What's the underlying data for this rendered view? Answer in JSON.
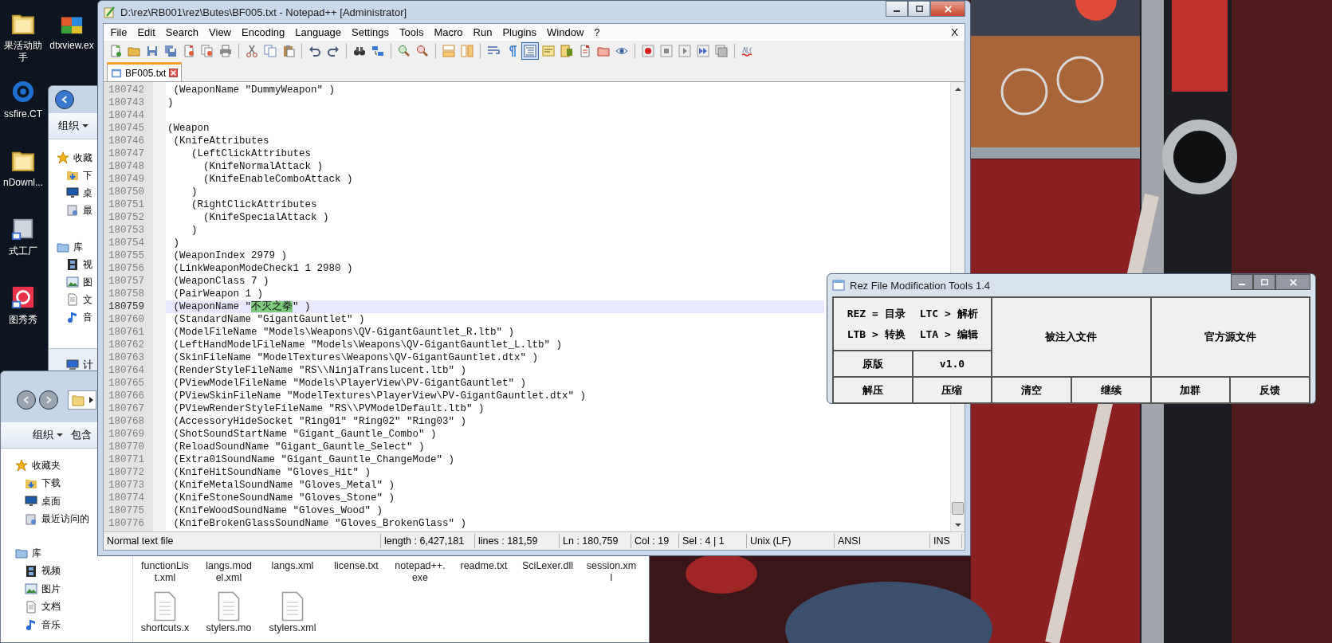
{
  "desktop": {
    "icons": [
      {
        "label": "果活动助手",
        "kind": "folder"
      },
      {
        "label": "ssfire.CT",
        "kind": "gear"
      },
      {
        "label": "nDownl...",
        "kind": "folder"
      },
      {
        "label": "式工厂",
        "kind": "converter"
      },
      {
        "label": "图秀秀",
        "kind": "red-app"
      }
    ],
    "second_column": [
      {
        "label": "dtxview.ex",
        "kind": "mfc"
      }
    ]
  },
  "explorer_back": {
    "organize": "组织",
    "nav": [
      {
        "label": "收藏",
        "kind": "star"
      },
      {
        "label": "下",
        "kind": "download"
      },
      {
        "label": "桌",
        "kind": "desktop"
      },
      {
        "label": "最",
        "kind": "recent"
      },
      {
        "label": "库",
        "kind": "library"
      },
      {
        "label": "视",
        "kind": "video"
      },
      {
        "label": "图",
        "kind": "picture"
      },
      {
        "label": "文",
        "kind": "document"
      },
      {
        "label": "音",
        "kind": "music"
      }
    ],
    "details": {
      "label": "计",
      "kind": "computer"
    }
  },
  "explorer_front": {
    "organize": "组织",
    "include": "包含",
    "nav": [
      {
        "label": "收藏夹",
        "kind": "star"
      },
      {
        "label": "下载",
        "kind": "download"
      },
      {
        "label": "桌面",
        "kind": "desktop"
      },
      {
        "label": "最近访问的",
        "kind": "recent"
      },
      {
        "label": "库",
        "kind": "library"
      },
      {
        "label": "视频",
        "kind": "video"
      },
      {
        "label": "图片",
        "kind": "picture"
      },
      {
        "label": "文档",
        "kind": "document"
      },
      {
        "label": "音乐",
        "kind": "music"
      }
    ],
    "files": [
      {
        "label": "functionList.xml"
      },
      {
        "label": "langs.model.xml"
      },
      {
        "label": "langs.xml"
      },
      {
        "label": "license.txt"
      },
      {
        "label": "notepad++.exe"
      },
      {
        "label": "readme.txt"
      },
      {
        "label": "SciLexer.dll"
      },
      {
        "label": "session.xml"
      }
    ],
    "files_row2": [
      {
        "label": "shortcuts.x"
      },
      {
        "label": "stylers.mo"
      },
      {
        "label": "stylers.xml"
      }
    ]
  },
  "notepad": {
    "title": "D:\\rez\\RB001\\rez\\Butes\\BF005.txt - Notepad++ [Administrator]",
    "menu": [
      "File",
      "Edit",
      "Search",
      "View",
      "Encoding",
      "Language",
      "Settings",
      "Tools",
      "Macro",
      "Run",
      "Plugins",
      "Window",
      "?"
    ],
    "doc_close": "X",
    "toolbar": [
      [
        {
          "kind": "new",
          "pressed": false
        },
        {
          "kind": "open",
          "pressed": false
        },
        {
          "kind": "save",
          "pressed": false
        },
        {
          "kind": "saveall",
          "pressed": false
        },
        {
          "kind": "close",
          "pressed": false
        },
        {
          "kind": "closeall",
          "pressed": false
        },
        {
          "kind": "print",
          "pressed": false
        }
      ],
      [
        {
          "kind": "cut",
          "pressed": false
        },
        {
          "kind": "copy",
          "pressed": false
        },
        {
          "kind": "paste",
          "pressed": false
        }
      ],
      [
        {
          "kind": "undo",
          "pressed": false
        },
        {
          "kind": "redo",
          "pressed": false
        }
      ],
      [
        {
          "kind": "find",
          "pressed": false
        },
        {
          "kind": "replace",
          "pressed": false
        }
      ],
      [
        {
          "kind": "zoomin",
          "pressed": false
        },
        {
          "kind": "zoomout",
          "pressed": false
        }
      ],
      [
        {
          "kind": "syncv",
          "pressed": false
        },
        {
          "kind": "synch",
          "pressed": false
        }
      ],
      [
        {
          "kind": "wrap",
          "pressed": false
        },
        {
          "kind": "allchars",
          "pressed": false
        },
        {
          "kind": "indent",
          "pressed": true
        },
        {
          "kind": "udl",
          "pressed": false
        },
        {
          "kind": "docmap",
          "pressed": false
        },
        {
          "kind": "funclist",
          "pressed": false
        },
        {
          "kind": "folderws",
          "pressed": false
        },
        {
          "kind": "monitor",
          "pressed": false
        }
      ],
      [
        {
          "kind": "record",
          "pressed": false
        },
        {
          "kind": "stop",
          "pressed": false
        },
        {
          "kind": "play",
          "pressed": false
        },
        {
          "kind": "playmulti",
          "pressed": false
        },
        {
          "kind": "savemacro",
          "pressed": false
        }
      ],
      [
        {
          "kind": "spell",
          "pressed": false
        }
      ]
    ],
    "tabs": [
      {
        "label": "BF005.txt",
        "selected": true
      }
    ],
    "lines": [
      {
        "no": "180742",
        "text": " (WeaponName \"DummyWeapon\" )",
        "current": false
      },
      {
        "no": "180743",
        "text": ")",
        "current": false
      },
      {
        "no": "180744",
        "current": false
      },
      {
        "no": "180745",
        "text": "(Weapon",
        "current": false
      },
      {
        "no": "180746",
        "text": " (KnifeAttributes",
        "current": false
      },
      {
        "no": "180747",
        "text": "    (LeftClickAttributes",
        "current": false
      },
      {
        "no": "180748",
        "text": "      (KnifeNormalAttack )",
        "current": false
      },
      {
        "no": "180749",
        "text": "      (KnifeEnableComboAttack )",
        "current": false
      },
      {
        "no": "180750",
        "text": "    )",
        "current": false
      },
      {
        "no": "180751",
        "text": "    (RightClickAttributes",
        "current": false
      },
      {
        "no": "180752",
        "text": "      (KnifeSpecialAttack )",
        "current": false
      },
      {
        "no": "180753",
        "text": "    )",
        "current": false
      },
      {
        "no": "180754",
        "text": " )",
        "current": false
      },
      {
        "no": "180755",
        "text": " (WeaponIndex 2979 )",
        "current": false
      },
      {
        "no": "180756",
        "text": " (LinkWeaponModeCheck1 1 2980 )",
        "current": false
      },
      {
        "no": "180757",
        "text": " (WeaponClass 7 )",
        "current": false
      },
      {
        "no": "180758",
        "text": " (PairWeapon 1 )",
        "current": false
      },
      {
        "no": "180759",
        "text": " (WeaponName \"",
        "selection": "不灭之拳",
        "after": "\" )",
        "current": true
      },
      {
        "no": "180760",
        "text": " (StandardName \"GigantGauntlet\" )",
        "current": false
      },
      {
        "no": "180761",
        "text": " (ModelFileName \"Models\\Weapons\\QV-GigantGauntlet_R.ltb\" )",
        "current": false
      },
      {
        "no": "180762",
        "text": " (LeftHandModelFileName \"Models\\Weapons\\QV-GigantGauntlet_L.ltb\" )",
        "current": false
      },
      {
        "no": "180763",
        "text": " (SkinFileName \"ModelTextures\\Weapons\\QV-GigantGauntlet.dtx\" )",
        "current": false
      },
      {
        "no": "180764",
        "text": " (RenderStyleFileName \"RS\\\\NinjaTranslucent.ltb\" )",
        "current": false
      },
      {
        "no": "180765",
        "text": " (PViewModelFileName \"Models\\PlayerView\\PV-GigantGauntlet\" )",
        "current": false
      },
      {
        "no": "180766",
        "text": " (PViewSkinFileName \"ModelTextures\\PlayerView\\PV-GigantGauntlet.dtx\" )",
        "current": false
      },
      {
        "no": "180767",
        "text": " (PViewRenderStyleFileName \"RS\\\\PVModelDefault.ltb\" )",
        "current": false
      },
      {
        "no": "180768",
        "text": " (AccessoryHideSocket \"Ring01\" \"Ring02\" \"Ring03\" )",
        "current": false
      },
      {
        "no": "180769",
        "text": " (ShotSoundStartName \"Gigant_Gauntle_Combo\" )",
        "current": false
      },
      {
        "no": "180770",
        "text": " (ReloadSoundName \"Gigant_Gauntle_Select\" )",
        "current": false
      },
      {
        "no": "180771",
        "text": " (Extra01SoundName \"Gigant_Gauntle_ChangeMode\" )",
        "current": false
      },
      {
        "no": "180772",
        "text": " (KnifeHitSoundName \"Gloves_Hit\" )",
        "current": false
      },
      {
        "no": "180773",
        "text": " (KnifeMetalSoundName \"Gloves_Metal\" )",
        "current": false
      },
      {
        "no": "180774",
        "text": " (KnifeStoneSoundName \"Gloves_Stone\" )",
        "current": false
      },
      {
        "no": "180775",
        "text": " (KnifeWoodSoundName \"Gloves_Wood\" )",
        "current": false
      },
      {
        "no": "180776",
        "text": " (KnifeBrokenGlassSoundName \"Gloves_BrokenGlass\" )",
        "current": false
      }
    ],
    "status_bar": [
      "Normal text file",
      "length : 6,427,181",
      "lines : 181,59",
      "Ln : 180,759",
      "Col : 19",
      "Sel : 4 | 1",
      "Unix (LF)",
      "ANSI",
      "INS"
    ]
  },
  "rez_tool": {
    "title": "Rez File Modification Tools 1.4",
    "info": [
      [
        "REZ = 目录",
        "LTC > 解析"
      ],
      [
        "LTB > 转换",
        "LTA > 编辑"
      ]
    ],
    "cells": [
      {
        "label": "原版",
        "kind": "button"
      },
      {
        "label": "v1.0",
        "kind": "label"
      },
      {
        "label": "被注入文件",
        "kind": "button"
      },
      {
        "label": "官方源文件",
        "kind": "button"
      },
      {
        "label": "解压",
        "kind": "button"
      },
      {
        "label": "压缩",
        "kind": "button"
      },
      {
        "label": "清空",
        "kind": "button"
      },
      {
        "label": "继续",
        "kind": "button"
      },
      {
        "label": "加群",
        "kind": "button"
      },
      {
        "label": "反馈",
        "kind": "button"
      }
    ]
  }
}
